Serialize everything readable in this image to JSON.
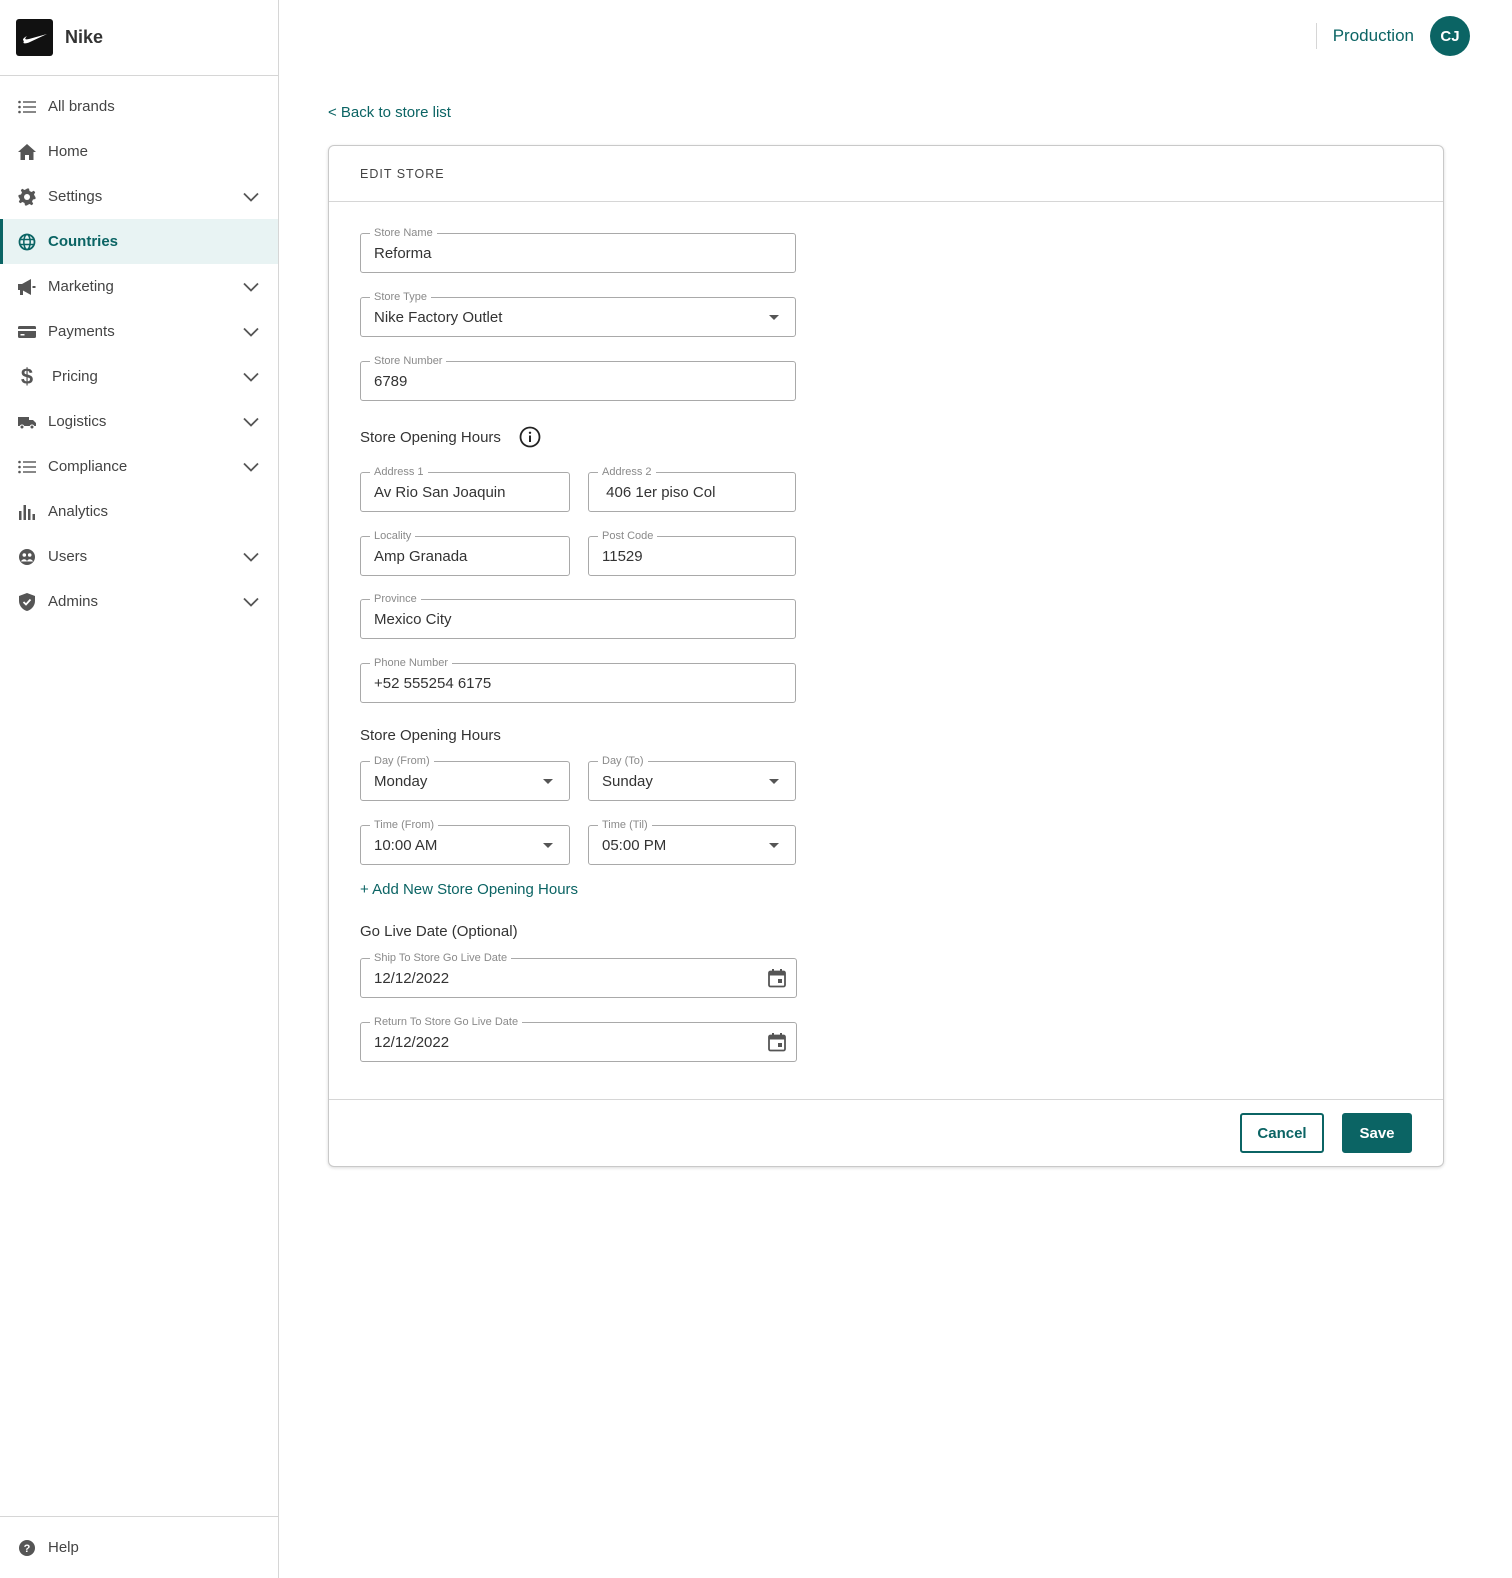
{
  "brand": {
    "name": "Nike",
    "logo_icon": "nike-swoosh-icon"
  },
  "sidebar": {
    "items": [
      {
        "label": "All brands",
        "icon": "list-icon",
        "expandable": false,
        "active": false
      },
      {
        "label": "Home",
        "icon": "home-icon",
        "expandable": false,
        "active": false
      },
      {
        "label": "Settings",
        "icon": "gear-icon",
        "expandable": true,
        "active": false
      },
      {
        "label": "Countries",
        "icon": "globe-icon",
        "expandable": false,
        "active": true
      },
      {
        "label": "Marketing",
        "icon": "megaphone-icon",
        "expandable": true,
        "active": false
      },
      {
        "label": "Payments",
        "icon": "credit-card-icon",
        "expandable": true,
        "active": false
      },
      {
        "label": "Pricing",
        "icon": "dollar-icon",
        "expandable": true,
        "active": false
      },
      {
        "label": "Logistics",
        "icon": "truck-icon",
        "expandable": true,
        "active": false
      },
      {
        "label": "Compliance",
        "icon": "list-icon",
        "expandable": true,
        "active": false
      },
      {
        "label": "Analytics",
        "icon": "bar-chart-icon",
        "expandable": false,
        "active": false
      },
      {
        "label": "Users",
        "icon": "users-icon",
        "expandable": true,
        "active": false
      },
      {
        "label": "Admins",
        "icon": "shield-icon",
        "expandable": true,
        "active": false
      }
    ],
    "help_label": "Help"
  },
  "header": {
    "environment": "Production",
    "avatar_initials": "CJ"
  },
  "back_link": "< Back to store list",
  "card": {
    "title": "EDIT STORE",
    "fields": {
      "store_name": {
        "label": "Store Name",
        "value": "Reforma"
      },
      "store_type": {
        "label": "Store Type",
        "value": "Nike Factory Outlet"
      },
      "store_number": {
        "label": "Store Number",
        "value": "6789"
      },
      "address1": {
        "label": "Address 1",
        "value": "Av Rio San Joaquin"
      },
      "address2": {
        "label": "Address 2",
        "value": " 406 1er piso Col"
      },
      "locality": {
        "label": "Locality",
        "value": "Amp Granada"
      },
      "post_code": {
        "label": "Post Code",
        "value": "11529"
      },
      "province": {
        "label": "Province",
        "value": "Mexico City"
      },
      "phone": {
        "label": "Phone Number",
        "value": "+52 555254 6175"
      },
      "day_from": {
        "label": "Day (From)",
        "value": "Monday"
      },
      "day_to": {
        "label": "Day (To)",
        "value": "Sunday"
      },
      "time_from": {
        "label": "Time (From)",
        "value": "10:00 AM"
      },
      "time_til": {
        "label": "Time (Til)",
        "value": "05:00 PM"
      },
      "ship_date": {
        "label": "Ship To Store Go Live Date",
        "value": "12/12/2022"
      },
      "return_date": {
        "label": "Return To Store Go Live Date",
        "value": "12/12/2022"
      }
    },
    "section_hours_1": "Store Opening Hours",
    "section_hours_2": "Store Opening Hours",
    "add_hours": "+ Add New Store Opening Hours",
    "section_golive": "Go Live Date (Optional)",
    "cancel_label": "Cancel",
    "save_label": "Save"
  },
  "colors": {
    "accent": "#0b6464",
    "active_bg": "#e8f3f3",
    "border": "#a9a9a9"
  }
}
